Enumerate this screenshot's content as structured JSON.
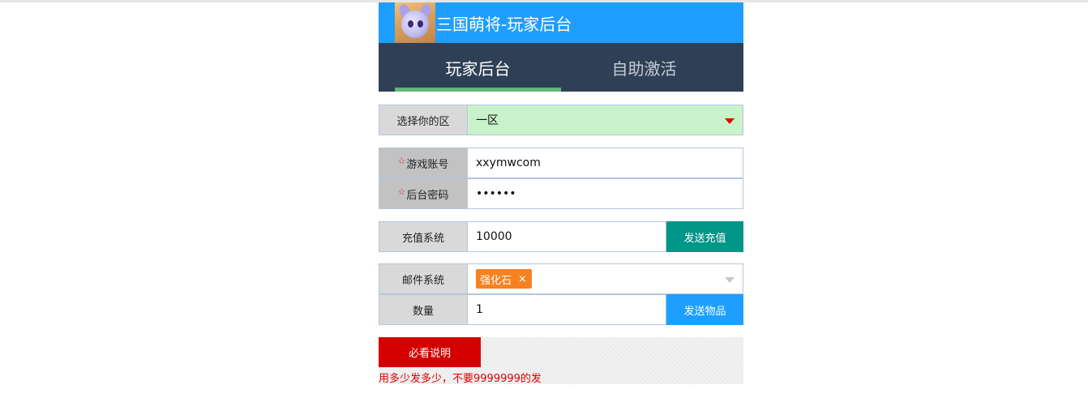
{
  "header": {
    "title": "三国萌将-玩家后台",
    "logo_icon": "game-avatar-icon"
  },
  "tabs": [
    {
      "label": "玩家后台",
      "active": true
    },
    {
      "label": "自助激活",
      "active": false
    }
  ],
  "server": {
    "label": "选择你的区",
    "value": "一区"
  },
  "account": {
    "label": "游戏账号",
    "value": "xxymwcom",
    "required_mark": "☆"
  },
  "password": {
    "label": "后台密码",
    "value": "••••••",
    "required_mark": "☆"
  },
  "recharge": {
    "label": "充值系统",
    "value": "10000",
    "button": "发送充值"
  },
  "mail": {
    "label": "邮件系统",
    "selected_tag": "强化石",
    "remove_symbol": "×"
  },
  "quantity": {
    "label": "数量",
    "value": "1",
    "button": "发送物品"
  },
  "notice": {
    "button": "必看说明",
    "hint": "用多少发多少，不要9999999的发"
  },
  "colors": {
    "header_blue": "#1e9fff",
    "nav_dark": "#2f4056",
    "tab_indicator": "#5fb878",
    "recharge_btn": "#009688",
    "tag_orange": "#f5811f",
    "notice_red": "#d40000"
  }
}
